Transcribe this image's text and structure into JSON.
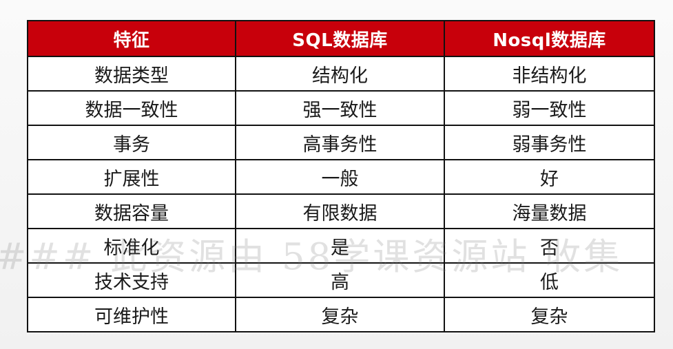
{
  "table": {
    "headers": [
      "特征",
      "SQL数据库",
      "Nosql数据库"
    ],
    "rows": [
      [
        "数据类型",
        "结构化",
        "非结构化"
      ],
      [
        "数据一致性",
        "强一致性",
        "弱一致性"
      ],
      [
        "事务",
        "高事务性",
        "弱事务性"
      ],
      [
        "扩展性",
        "一般",
        "好"
      ],
      [
        "数据容量",
        "有限数据",
        "海量数据"
      ],
      [
        "标准化",
        "是",
        "否"
      ],
      [
        "技术支持",
        "高",
        "低"
      ],
      [
        "可维护性",
        "复杂",
        "复杂"
      ]
    ]
  },
  "watermark": "### 此资源由 58学课资源站 收集",
  "colors": {
    "header_bg": "#c8000b",
    "header_text": "#ffffff",
    "border": "#111111",
    "cell_bg": "#ffffff"
  }
}
